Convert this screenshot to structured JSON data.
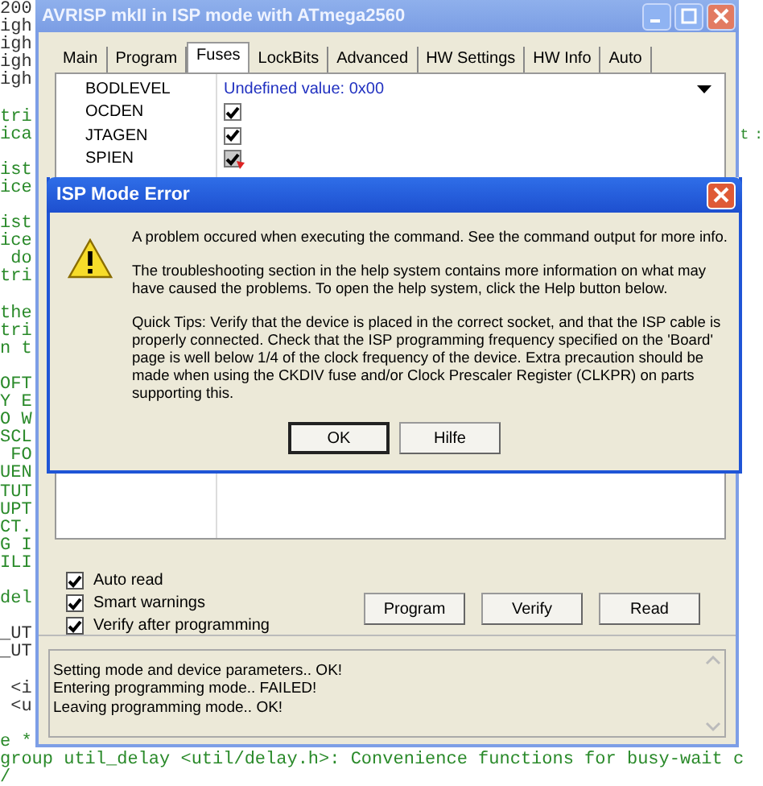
{
  "editor": {
    "blocks": [
      [
        {
          "text": "200",
          "kind": "code"
        },
        {
          "text": "igh",
          "kind": "code"
        },
        {
          "text": "igh",
          "kind": "code"
        },
        {
          "text": "igh",
          "kind": "code"
        },
        {
          "text": "igh",
          "kind": "code"
        }
      ],
      [
        {
          "text": "tri",
          "kind": "comment"
        },
        {
          "text": "ica",
          "kind": "comment",
          "right": "t :"
        }
      ],
      [
        {
          "text": "ist",
          "kind": "comment"
        },
        {
          "text": "ice",
          "kind": "comment"
        }
      ],
      [
        {
          "text": "ist",
          "kind": "comment"
        },
        {
          "text": "ice",
          "kind": "comment"
        },
        {
          "text": " do",
          "kind": "comment"
        },
        {
          "text": "tri",
          "kind": "comment"
        }
      ],
      [
        {
          "text": "the",
          "kind": "comment"
        },
        {
          "text": "tri",
          "kind": "comment"
        },
        {
          "text": "n t",
          "kind": "comment"
        }
      ],
      [
        {
          "text": "OFT",
          "kind": "comment"
        },
        {
          "text": "Y E",
          "kind": "comment"
        },
        {
          "text": "O W",
          "kind": "comment"
        },
        {
          "text": "SCL",
          "kind": "comment"
        },
        {
          "text": " FO",
          "kind": "comment"
        },
        {
          "text": "UEN",
          "kind": "comment"
        },
        {
          "text": "TUT",
          "kind": "comment"
        },
        {
          "text": "UPT",
          "kind": "comment"
        },
        {
          "text": "CT.",
          "kind": "comment"
        },
        {
          "text": "G I",
          "kind": "comment"
        },
        {
          "text": "ILI",
          "kind": "comment"
        }
      ],
      [
        {
          "text": "del",
          "kind": "comment"
        }
      ],
      [
        {
          "text": "_UT",
          "kind": "code"
        },
        {
          "text": "_UT",
          "kind": "code"
        }
      ],
      [
        {
          "text": " <i",
          "kind": "code"
        },
        {
          "text": " <u",
          "kind": "code"
        }
      ],
      [
        {
          "text": "e *",
          "kind": "comment"
        },
        {
          "text": "group util_delay <util/delay.h>: Convenience functions for busy-wait c",
          "kind": "comment"
        },
        {
          "text": "/",
          "kind": "comment"
        }
      ]
    ]
  },
  "window": {
    "title": "AVRISP mkII in ISP mode with ATmega2560",
    "tabs": [
      {
        "label": "Main",
        "selected": false
      },
      {
        "label": "Program",
        "selected": false
      },
      {
        "label": "Fuses",
        "selected": true
      },
      {
        "label": "LockBits",
        "selected": false
      },
      {
        "label": "Advanced",
        "selected": false
      },
      {
        "label": "HW Settings",
        "selected": false
      },
      {
        "label": "HW Info",
        "selected": false
      },
      {
        "label": "Auto",
        "selected": false
      }
    ],
    "fuses": [
      {
        "name": "BODLEVEL",
        "kind": "dropdown",
        "value": "Undefined value: 0x00"
      },
      {
        "name": "OCDEN",
        "kind": "checkbox",
        "checked": true,
        "disabled": false
      },
      {
        "name": "JTAGEN",
        "kind": "checkbox",
        "checked": true,
        "disabled": false
      },
      {
        "name": "SPIEN",
        "kind": "checkbox",
        "checked": true,
        "disabled": true
      }
    ],
    "options": [
      {
        "label": "Auto read",
        "checked": true
      },
      {
        "label": "Smart warnings",
        "checked": true
      },
      {
        "label": "Verify after programming",
        "checked": true
      }
    ],
    "buttons": [
      "Program",
      "Verify",
      "Read"
    ],
    "log": [
      "Setting mode and device parameters.. OK!",
      "Entering programming mode.. FAILED!",
      "Leaving programming mode.. OK!"
    ]
  },
  "dialog": {
    "title": "ISP Mode Error",
    "paragraphs": [
      "A problem occured when executing the command. See the command output for more info.",
      "The troubleshooting section in the help system contains more information on what may have caused the problems. To open the help system, click the Help button below.",
      "Quick Tips: Verify that the device is placed in the correct socket, and that the ISP cable is properly connected. Check that the ISP programming frequency specified on the 'Board' page is well below 1/4 of the clock frequency of the device. Extra precaution should be made when using the CKDIV fuse and/or Clock Prescaler Register (CLKPR) on parts supporting this."
    ],
    "buttons": [
      {
        "label": "OK",
        "selected": true
      },
      {
        "label": "Hilfe",
        "selected": false
      }
    ]
  }
}
